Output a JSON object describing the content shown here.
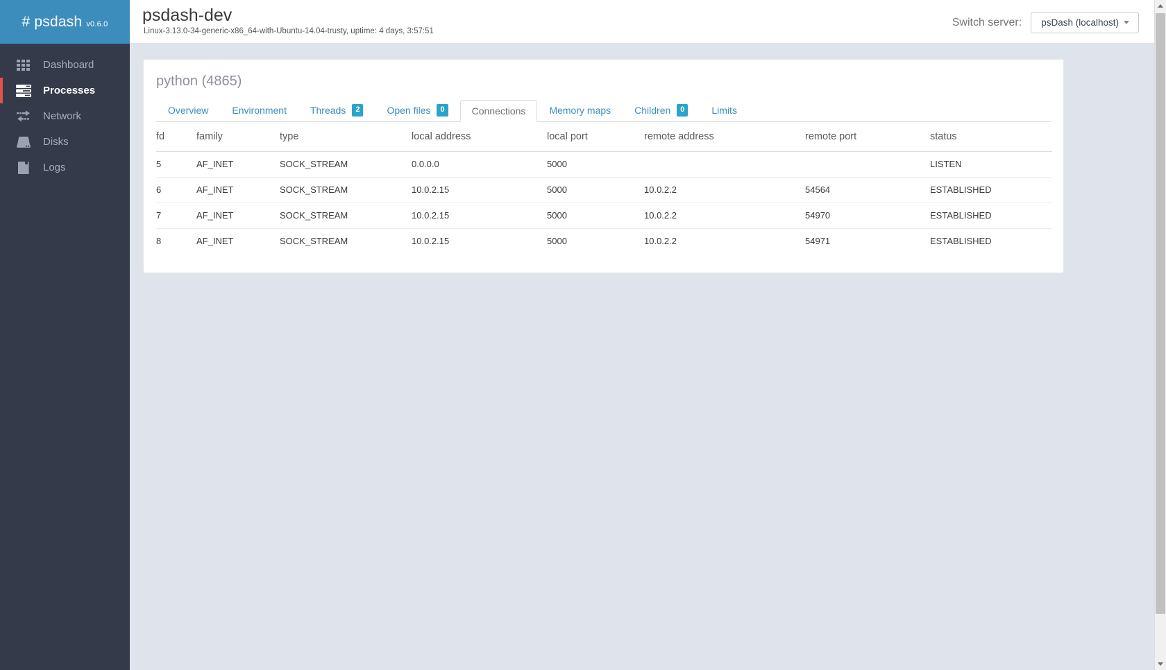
{
  "brand": {
    "name": "# psdash",
    "version": "v0.6.0"
  },
  "sidebar": {
    "items": [
      {
        "label": "Dashboard",
        "icon": "grid-icon",
        "active": false
      },
      {
        "label": "Processes",
        "icon": "server-stack-icon",
        "active": true
      },
      {
        "label": "Network",
        "icon": "network-arrows-icon",
        "active": false
      },
      {
        "label": "Disks",
        "icon": "disk-icon",
        "active": false
      },
      {
        "label": "Logs",
        "icon": "book-icon",
        "active": false
      }
    ]
  },
  "header": {
    "title": "psdash-dev",
    "subtitle": "Linux-3.13.0-34-generic-x86_64-with-Ubuntu-14.04-trusty, uptime: 4 days, 3:57:51",
    "switch_server_label": "Switch server:",
    "selected_server": "psDash (localhost)"
  },
  "process": {
    "title": "python (4865)",
    "tabs": [
      {
        "label": "Overview",
        "badge": null,
        "active": false
      },
      {
        "label": "Environment",
        "badge": null,
        "active": false
      },
      {
        "label": "Threads",
        "badge": "2",
        "active": false
      },
      {
        "label": "Open files",
        "badge": "0",
        "active": false
      },
      {
        "label": "Connections",
        "badge": null,
        "active": true
      },
      {
        "label": "Memory maps",
        "badge": null,
        "active": false
      },
      {
        "label": "Children",
        "badge": "0",
        "active": false
      },
      {
        "label": "Limits",
        "badge": null,
        "active": false
      }
    ]
  },
  "connections_table": {
    "columns": [
      "fd",
      "family",
      "type",
      "local address",
      "local port",
      "remote address",
      "remote port",
      "status"
    ],
    "rows": [
      {
        "fd": "5",
        "family": "AF_INET",
        "type": "SOCK_STREAM",
        "local_address": "0.0.0.0",
        "local_port": "5000",
        "remote_address": "",
        "remote_port": "",
        "status": "LISTEN"
      },
      {
        "fd": "6",
        "family": "AF_INET",
        "type": "SOCK_STREAM",
        "local_address": "10.0.2.15",
        "local_port": "5000",
        "remote_address": "10.0.2.2",
        "remote_port": "54564",
        "status": "ESTABLISHED"
      },
      {
        "fd": "7",
        "family": "AF_INET",
        "type": "SOCK_STREAM",
        "local_address": "10.0.2.15",
        "local_port": "5000",
        "remote_address": "10.0.2.2",
        "remote_port": "54970",
        "status": "ESTABLISHED"
      },
      {
        "fd": "8",
        "family": "AF_INET",
        "type": "SOCK_STREAM",
        "local_address": "10.0.2.15",
        "local_port": "5000",
        "remote_address": "10.0.2.2",
        "remote_port": "54971",
        "status": "ESTABLISHED"
      }
    ]
  },
  "colors": {
    "brand_blue": "#3c8dbc",
    "sidebar_dark": "#343a4a",
    "accent_red": "#e0524a",
    "badge_teal": "#2aa4cb",
    "link_blue": "#3c8dbc",
    "content_bg": "#dfe3eb"
  }
}
